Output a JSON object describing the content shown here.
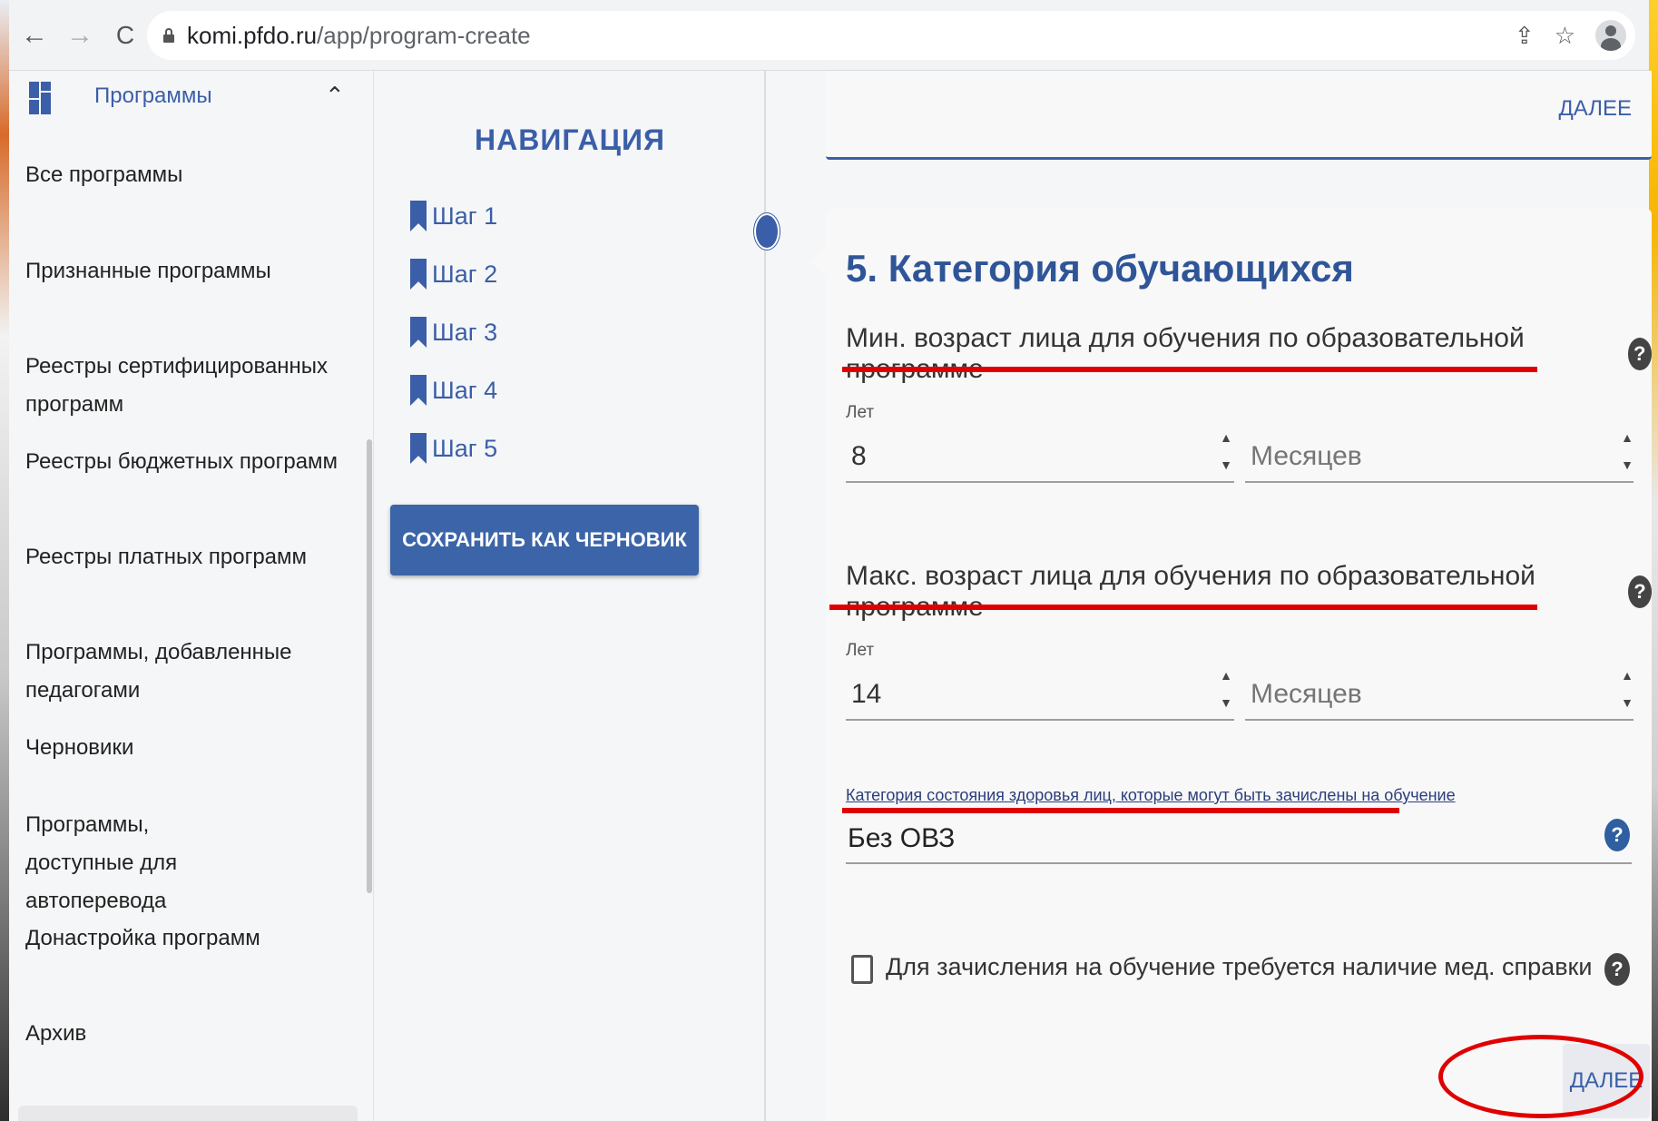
{
  "browser": {
    "url_host": "komi.pfdo.ru",
    "url_path": "/app/program-create",
    "back_icon": "←",
    "forward_icon": "→",
    "reload_icon": "C",
    "share_icon": "⇪",
    "star_icon": "☆"
  },
  "sidebar": {
    "title": "Программы",
    "chevron": "^",
    "items": [
      "Все программы",
      "Признанные программы",
      "Реестры сертифицированных программ",
      "Реестры бюджетных программ",
      "Реестры платных программ",
      "Программы, добавленные педагогами",
      "Черновики",
      "Программы, доступные для автоперевода",
      "Донастройка программ",
      "Архив"
    ]
  },
  "navigation": {
    "title": "НАВИГАЦИЯ",
    "steps": [
      "Шаг 1",
      "Шаг 2",
      "Шаг 3",
      "Шаг 4",
      "Шаг 5"
    ],
    "save_draft_label": "СОХРАНИТЬ КАК ЧЕРНОВИК"
  },
  "main": {
    "next_label": "ДАЛЕЕ",
    "section_title": "5. Категория обучающихся",
    "min_age": {
      "heading": "Мин. возраст лица для обучения по образовательной программе",
      "years_label": "Лет",
      "years_value": "8",
      "months_placeholder": "Месяцев"
    },
    "max_age": {
      "heading": "Макс. возраст лица для обучения по образовательной программе",
      "years_label": "Лет",
      "years_value": "14",
      "months_placeholder": "Месяцев"
    },
    "health": {
      "label": "Категория состояния здоровья лиц, которые могут быть зачислены на обучение",
      "value": "Без ОВЗ"
    },
    "med_certificate": {
      "label": "Для зачисления на обучение требуется наличие мед. справки",
      "checked": false
    },
    "help_icon": "?",
    "spin_up": "▲",
    "spin_down": "▼"
  },
  "colors": {
    "accent": "#3b5ea8",
    "highlight": "#e00000"
  }
}
